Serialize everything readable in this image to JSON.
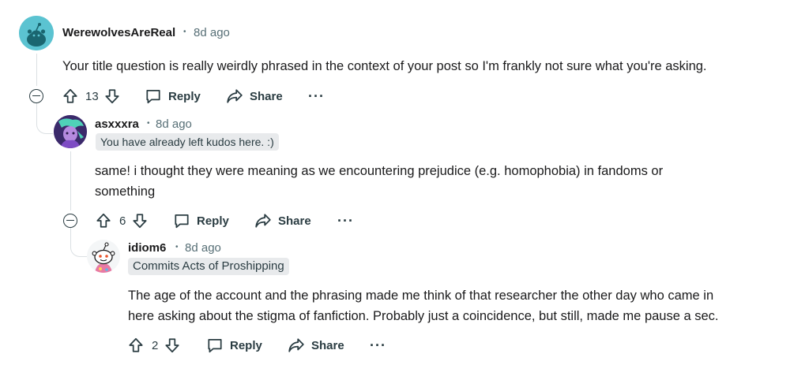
{
  "comments": [
    {
      "username": "WerewolvesAreReal",
      "age": "8d ago",
      "body": "Your title question is really weirdly phrased in the context of your post so I'm frankly not sure what you're asking.",
      "votes": "13",
      "reply_label": "Reply",
      "share_label": "Share",
      "more_label": "···",
      "avatar_color": "#5bc3d1"
    },
    {
      "username": "asxxxra",
      "age": "8d ago",
      "flair": "You have already left kudos here. :)",
      "body_line1": "same! i thought they were meaning as we encountering prejudice (e.g. homophobia) in fandoms or",
      "body_line2": "something",
      "votes": "6",
      "reply_label": "Reply",
      "share_label": "Share",
      "more_label": "···",
      "avatar_color": "#6b3fa0"
    },
    {
      "username": "idiom6",
      "age": "8d ago",
      "flair": "Commits Acts of Proshipping",
      "body_line1": "The age of the account and the phrasing made me think of that researcher the other day who came in",
      "body_line2": "here asking about the stigma of fanfiction. Probably just a coincidence, but still, made me pause a sec.",
      "votes": "2",
      "reply_label": "Reply",
      "share_label": "Share",
      "more_label": "···",
      "avatar_color": "#ffffff"
    }
  ],
  "separator": "•"
}
